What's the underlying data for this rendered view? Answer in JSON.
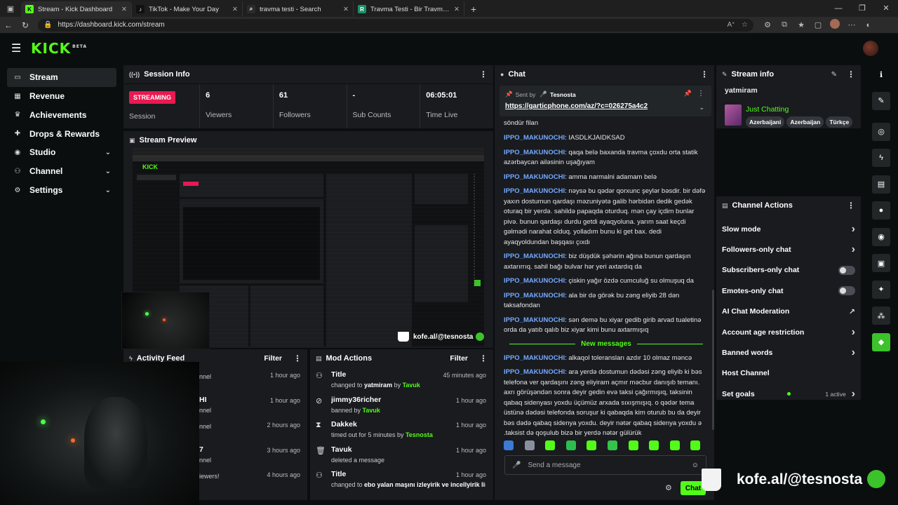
{
  "browser": {
    "tabs": [
      {
        "title": "Stream - Kick Dashboard",
        "fav_color": "#53fc18",
        "fav": "K",
        "active": true
      },
      {
        "title": "TikTok - Make Your Day",
        "fav_color": "#111111",
        "fav": "♪",
        "active": false
      },
      {
        "title": "travma testi - Search",
        "fav_color": "#2b2b2b",
        "fav": "⌕",
        "active": false
      },
      {
        "title": "Travma Testi - Bir Travma Yaşadın",
        "fav_color": "#1b8f6a",
        "fav": "R",
        "active": false
      }
    ],
    "url": "https://dashboard.kick.com/stream"
  },
  "brand": {
    "logo": "KICK",
    "beta": "BETA",
    "accent": "#53fc18",
    "live_color": "#e91951"
  },
  "sidebar": {
    "items": [
      {
        "label": "Stream",
        "icon": "broadcast-icon",
        "glyph": "▭",
        "chev": ""
      },
      {
        "label": "Revenue",
        "icon": "revenue-icon",
        "glyph": "▦",
        "chev": ""
      },
      {
        "label": "Achievements",
        "icon": "trophy-icon",
        "glyph": "♛",
        "chev": ""
      },
      {
        "label": "Drops & Rewards",
        "icon": "gift-icon",
        "glyph": "✚",
        "chev": ""
      },
      {
        "label": "Studio",
        "icon": "studio-icon",
        "glyph": "◉",
        "chev": "⌄"
      },
      {
        "label": "Channel",
        "icon": "channel-icon",
        "glyph": "⚇",
        "chev": "⌄"
      },
      {
        "label": "Settings",
        "icon": "gear-icon",
        "glyph": "⚙",
        "chev": "⌄"
      }
    ]
  },
  "session": {
    "title": "Session Info",
    "status": "STREAMING",
    "status_label": "Session",
    "stats": [
      {
        "value": "6",
        "label": "Viewers"
      },
      {
        "value": "61",
        "label": "Followers"
      },
      {
        "value": "-",
        "label": "Sub Counts"
      },
      {
        "value": "06:05:01",
        "label": "Time Live"
      }
    ]
  },
  "preview": {
    "title": "Stream Preview",
    "watermark": "kofe.al/@tesnosta",
    "mini_watermark": "kofe.al/@tesnosta"
  },
  "activity": {
    "title": "Activity Feed",
    "filter": "Filter",
    "rows": [
      {
        "name": "",
        "sub": "nnel",
        "time": "1 hour ago"
      },
      {
        "name": "HI",
        "sub": "nnel",
        "time": "1 hour ago"
      },
      {
        "name": "",
        "sub": "nnel",
        "time": "2 hours ago"
      },
      {
        "name": "7",
        "sub": "nnel",
        "time": "3 hours ago"
      },
      {
        "name": "",
        "sub": "iewers!",
        "time": "4 hours ago"
      }
    ]
  },
  "mod": {
    "title": "Mod Actions",
    "filter": "Filter",
    "rows": [
      {
        "icon": "users-icon",
        "glyph": "⚇",
        "name": "Title",
        "pre": "changed to ",
        "target": "yatmiram",
        "mid": " by ",
        "by": "Tavuk",
        "time": "45 minutes ago"
      },
      {
        "icon": "ban-icon",
        "glyph": "⊘",
        "name": "jimmy36richer",
        "pre": "banned by ",
        "target": "",
        "mid": "",
        "by": "Tavuk",
        "time": "1 hour ago"
      },
      {
        "icon": "hourglass-icon",
        "glyph": "⧗",
        "name": "Dakkek",
        "pre": "timed out for 5 minutes by ",
        "target": "",
        "mid": "",
        "by": "Tesnosta",
        "time": "1 hour ago"
      },
      {
        "icon": "trash-icon",
        "glyph": "🗑",
        "name": "Tavuk",
        "pre": "deleted a message",
        "target": "",
        "mid": "",
        "by": "",
        "time": "1 hour ago"
      },
      {
        "icon": "users-icon",
        "glyph": "⚇",
        "name": "Title",
        "pre": "changed to ",
        "target": "ebo yalan maşını izleyirik ve incellyirik linsta",
        "mid": " by ",
        "by": "Tavuk",
        "time": "1 hour ago"
      }
    ]
  },
  "chat": {
    "title": "Chat",
    "pinned_sent": "Sent by",
    "pinned_user": "Tesnosta",
    "pinned_link": "https://garticphone.com/az/?c=026275a4c2",
    "top_line": "söndür filan",
    "messages": [
      {
        "user": "IPPO_MAKUNOCHI",
        "text": "IASDLKJAIDKSAD"
      },
      {
        "user": "IPPO_MAKUNOCHI",
        "text": "qaqa belə baxanda travma çoxdu orta statik azərbaycan ailəsinin uşağıyam"
      },
      {
        "user": "IPPO_MAKUNOCHI",
        "text": "amma narmalni adamam belə"
      },
      {
        "user": "IPPO_MAKUNOCHI",
        "text": "nəysə bu qədər qorxunc şeylər bəsdir. bir dəfə yaxın dostumun qardaşı məzuniyətə galib hərbidən dedik gedək oturaq bir yerdə. sahildə papaqda oturduq. mən çay içdim bunlar pivə. bunun qardaşı durdu getdi ayaqyoluna. yarım saat keçdi gəlmədi narahat olduq. yolladım bunu ki get bax. dedi ayaqyoldundan başqası çıxdı"
      },
      {
        "user": "IPPO_MAKUNOCHI",
        "text": "biz düşdük şəhərin ağına bunun qardaşın axtarırrıq. sahil bağı bulvar hər yeri axtardıq da"
      },
      {
        "user": "IPPO_MAKUNOCHI",
        "text": "çiskin yağır özdə cumculuğ su olmuşuq da"
      },
      {
        "user": "IPPO_MAKUNOCHI",
        "text": "ala bir də görək bu zəng eliyib 28 dən taksafondan"
      },
      {
        "user": "IPPO_MAKUNOCHI",
        "text": "sən demə bu xiyar gedib girib arvad tualetinə orda da yatıb qalıb biz xiyar kimi bunu axtarmışıq"
      }
    ],
    "new_messages": "New messages",
    "new": [
      {
        "user": "IPPO_MAKUNOCHI",
        "text": "alkaqol toleransları azdır 10 olmaz məncə"
      },
      {
        "user": "IPPO_MAKUNOCHI",
        "text": "ara yerdə dostumun dədəsi zəng eliyib ki bəs telefona ver qardaşını zəng eliyiram açmır məcbur danışıb temanı. axrı görüşəndən sonra deyir gedin evə taksi çağırmışıq, taksinin qabaq sidenyası yoxdu üçümüz arxada sıxışmışıq. o qədər tema üstünə dədəsi telefonda soruşur ki qabaqda kim oturub bu da deyir bəs dədə qabaq sidenya yoxdu. deyir nətər qabaq sidenya yoxdu ə .taksist də qoşulub bizə bir yerdə nətər gülürük"
      }
    ],
    "emote_colors": [
      "#3a7bd5",
      "#8a8fa0",
      "#53fc18",
      "#2dbd4e",
      "#53fc18",
      "#34c24a",
      "#53fc18",
      "#53fc18",
      "#53fc18",
      "#53fc18"
    ],
    "placeholder": "Send a message",
    "send": "Chat"
  },
  "stream_info": {
    "title": "Stream info",
    "stream_title": "yatmiram",
    "category": "Just Chatting",
    "tags": [
      "Azerbaijani",
      "Azerbaijan",
      "Türkçe"
    ]
  },
  "actions": {
    "title": "Channel Actions",
    "rows": [
      {
        "label": "Slow mode",
        "kind": "arrow",
        "extra": ""
      },
      {
        "label": "Followers-only chat",
        "kind": "arrow",
        "extra": ""
      },
      {
        "label": "Subscribers-only chat",
        "kind": "toggle",
        "extra": ""
      },
      {
        "label": "Emotes-only chat",
        "kind": "toggle",
        "extra": ""
      },
      {
        "label": "AI Chat Moderation",
        "kind": "external",
        "extra": ""
      },
      {
        "label": "Account age restriction",
        "kind": "arrow",
        "extra": ""
      },
      {
        "label": "Banned words",
        "kind": "arrow",
        "extra": ""
      },
      {
        "label": "Host Channel",
        "kind": "none",
        "extra": ""
      },
      {
        "label": "Set goals",
        "kind": "arrow",
        "extra": "1 active"
      }
    ]
  },
  "rail": [
    {
      "icon": "info-icon",
      "glyph": "ℹ"
    },
    {
      "icon": "edit-icon",
      "glyph": "✎"
    },
    {
      "icon": "capture-icon",
      "glyph": "◎"
    },
    {
      "icon": "lightning-icon",
      "glyph": "ϟ"
    },
    {
      "icon": "document-icon",
      "glyph": "▤"
    },
    {
      "icon": "chat-bubble-icon",
      "glyph": "●"
    },
    {
      "icon": "broadcast-icon",
      "glyph": "◉"
    },
    {
      "icon": "layout-icon",
      "glyph": "▣"
    },
    {
      "icon": "wrench-icon",
      "glyph": "✦"
    },
    {
      "icon": "integrations-icon",
      "glyph": "⁂"
    },
    {
      "icon": "app-icon",
      "glyph": "◆"
    }
  ]
}
